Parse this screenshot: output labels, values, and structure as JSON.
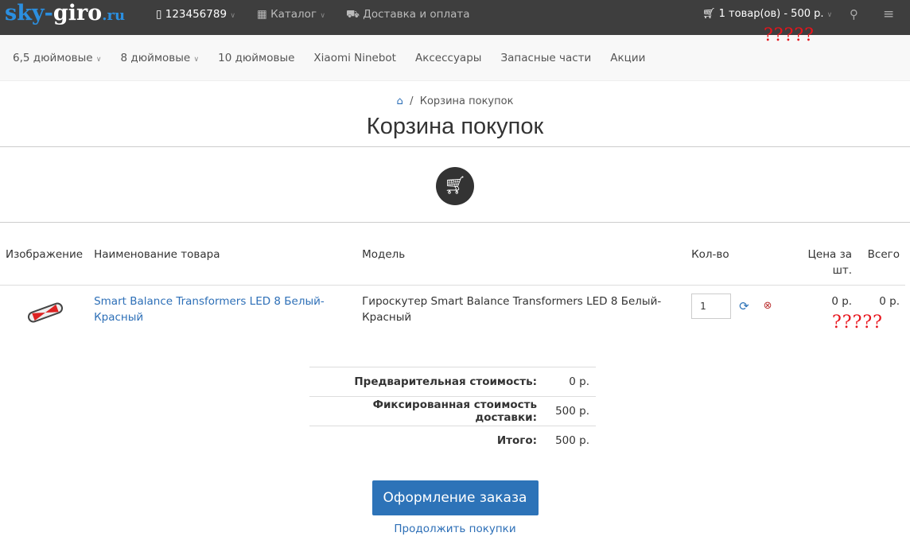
{
  "header": {
    "logo_a": "sky-",
    "logo_b": "giro",
    "logo_c": ".ru",
    "phone": "123456789",
    "catalog": "Каталог",
    "delivery": "Доставка и оплата",
    "cart": "1 товар(ов) - 500 р.",
    "annotation": "?????"
  },
  "nav": [
    "6,5 дюймовые",
    "8 дюймовые",
    "10 дюймовые",
    "Xiaomi Ninebot",
    "Аксессуары",
    "Запасные части",
    "Акции"
  ],
  "breadcrumb": "Корзина покупок",
  "title": "Корзина покупок",
  "table": {
    "headers": [
      "Изображение",
      "Наименование товара",
      "Модель",
      "Кол-во",
      "Цена за шт.",
      "Всего"
    ],
    "row": {
      "name": "Smart Balance Transformers LED 8 Белый-Красный",
      "model": "Гироскутер Smart Balance Transformers LED 8 Белый-Красный",
      "qty": "1",
      "price": "0 р.",
      "total": "0 р.",
      "annotation": "?????"
    }
  },
  "totals": [
    {
      "label": "Предварительная стоимость:",
      "value": "0 р."
    },
    {
      "label": "Фиксированная стоимость доставки:",
      "value": "500 р."
    },
    {
      "label": "Итого:",
      "value": "500 р."
    }
  ],
  "checkout": "Оформление заказа",
  "continue": "Продолжить покупки"
}
